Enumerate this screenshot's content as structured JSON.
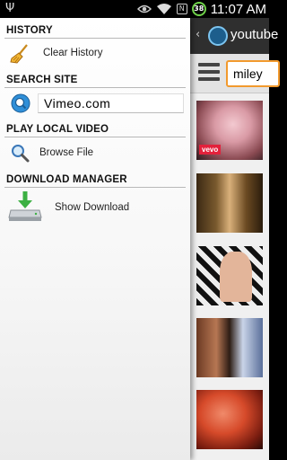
{
  "status_bar": {
    "time": "11:07 AM",
    "battery": "38",
    "icons": [
      "usb-icon",
      "eye-icon",
      "wifi-icon",
      "nfc-icon",
      "battery-icon"
    ]
  },
  "drawer": {
    "history": {
      "title": "HISTORY",
      "clear_label": "Clear History"
    },
    "search_site": {
      "title": "SEARCH SITE",
      "site_value": "Vimeo.com"
    },
    "play_local": {
      "title": "PLAY LOCAL VIDEO",
      "browse_label": "Browse File"
    },
    "download_manager": {
      "title": "DOWNLOAD MANAGER",
      "show_label": "Show Download"
    }
  },
  "app": {
    "title": "youtube",
    "search_value": "miley",
    "thumbnail_badge": "vevo"
  },
  "colors": {
    "accent_orange": "#f29a2e",
    "battery_green": "#6fd24a",
    "download_green": "#3cb043",
    "app_bar": "#2f2f2f"
  }
}
